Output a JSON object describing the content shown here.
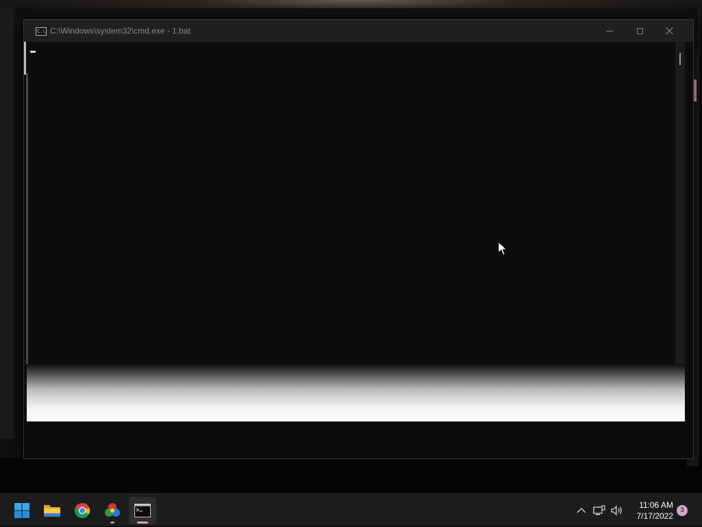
{
  "window": {
    "title": "C:\\Windows\\system32\\cmd.exe - 1.bat",
    "icon_text": "C:\\"
  },
  "taskbar": {
    "apps": [
      {
        "name": "Start",
        "icon": "windows-logo-icon"
      },
      {
        "name": "File Explorer",
        "icon": "folder-icon"
      },
      {
        "name": "Google Chrome",
        "icon": "chrome-icon"
      },
      {
        "name": "Colorful app",
        "icon": "color-wheel-icon"
      },
      {
        "name": "Command Prompt",
        "icon": "cmd-icon"
      }
    ],
    "clock": {
      "time": "11:06 AM",
      "date": "7/17/2022"
    },
    "notification_count": "3"
  },
  "colors": {
    "console_bg": "#0c0c0c",
    "titlebar_bg": "#1f1f1f",
    "taskbar_bg": "#1c1c1c",
    "accent": "#d9a3c8"
  }
}
